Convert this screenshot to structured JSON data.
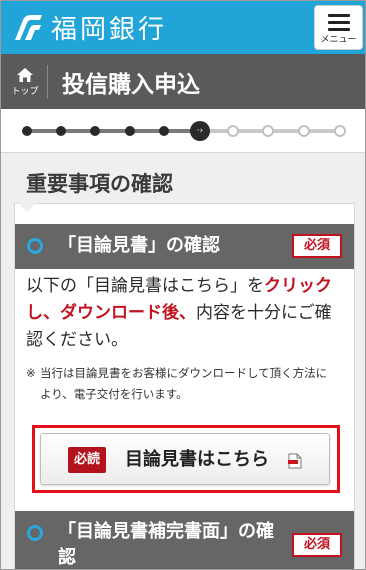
{
  "header": {
    "logo_text": "福岡銀行",
    "menu_label": "メニュー"
  },
  "titlebar": {
    "home_label": "トップ",
    "title": "投信購入申込"
  },
  "progress": {
    "current_step": 6,
    "total_steps": 10,
    "current_symbol": "·›"
  },
  "section": {
    "title": "重要事項の確認"
  },
  "item1": {
    "title": "「目論見書」の確認",
    "badge": "必須",
    "instruction": {
      "part1": "以下の「目論見書はこちら」を",
      "emphasis": "クリックし、ダウンロード後、",
      "part2": "内容を十分にご確認ください。"
    },
    "note_mark": "※",
    "note": "当行は目論見書をお客様にダウンロードして頂く方法により、電子交付を行います。",
    "button": {
      "tag": "必読",
      "label": "目論見書はこちら"
    }
  },
  "item2": {
    "title": "「目論見書補完書面」の確認",
    "badge": "必須"
  },
  "colors": {
    "brand": "#21a4d8",
    "title_bar": "#5a5a5a",
    "required_red": "#c1121f",
    "highlight_red": "#e3101b"
  }
}
